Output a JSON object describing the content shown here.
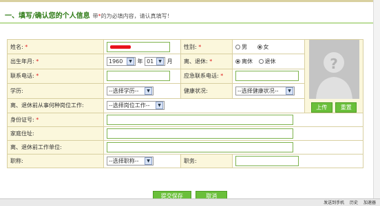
{
  "section": {
    "title": "一、填写/确认您的个人信息",
    "note_prefix": "带",
    "note_star": "*",
    "note_suffix": "的为必填内容，请认真填写！"
  },
  "fields": {
    "name_label": "姓名:",
    "gender_label": "性别:",
    "gender_male": "男",
    "gender_female": "女",
    "gender_selected": "女",
    "birth_label": "出生年月:",
    "birth_year": "1960",
    "year_unit": "年",
    "birth_month": "01",
    "month_unit": "月",
    "retire_label": "离、退休:",
    "retire_option1": "离休",
    "retire_option2": "退休",
    "retire_selected": "离休",
    "phone_label": "联系电话:",
    "emergency_phone_label": "应急联系电话:",
    "education_label": "学历:",
    "education_select": "--选择学历--",
    "health_label": "健康状况:",
    "health_select": "--选择健康状况--",
    "position_label": "离、退休前从事何种岗位工作:",
    "position_select": "--选择岗位工作--",
    "id_label": "身份证号:",
    "address_label": "家庭住址:",
    "work_unit_label": "离、退休前工作单位:",
    "title_label": "职称:",
    "title_select": "--选择职称--",
    "duty_label": "职务:"
  },
  "required_star": "*",
  "photo": {
    "upload": "上传",
    "reset": "重置"
  },
  "actions": {
    "submit": "提交保存",
    "cancel": "取消"
  },
  "statusbar": {
    "item1": "发送到手机",
    "item2": "历史",
    "item3": "加速器"
  },
  "colors": {
    "title_green": "#2c7a14",
    "label_bg": "#fbf7dc",
    "button_green": "#6abf3a",
    "required_red": "#e02020"
  }
}
